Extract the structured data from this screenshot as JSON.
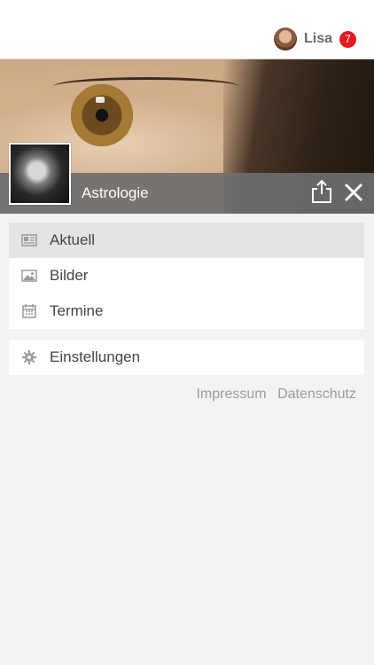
{
  "header": {
    "user_name": "Lisa",
    "notification_count": "7"
  },
  "hero": {
    "title": "Astrologie"
  },
  "menu": {
    "items": [
      {
        "label": "Aktuell",
        "icon": "news-icon",
        "active": true
      },
      {
        "label": "Bilder",
        "icon": "image-icon",
        "active": false
      },
      {
        "label": "Termine",
        "icon": "calendar-icon",
        "active": false
      }
    ]
  },
  "settings": {
    "label": "Einstellungen",
    "icon": "gear-icon"
  },
  "footer_links": {
    "impressum": "Impressum",
    "datenschutz": "Datenschutz"
  },
  "colors": {
    "badge": "#e11b22",
    "hero_bar": "#6e6e6e",
    "active_item": "#e4e4e4"
  }
}
